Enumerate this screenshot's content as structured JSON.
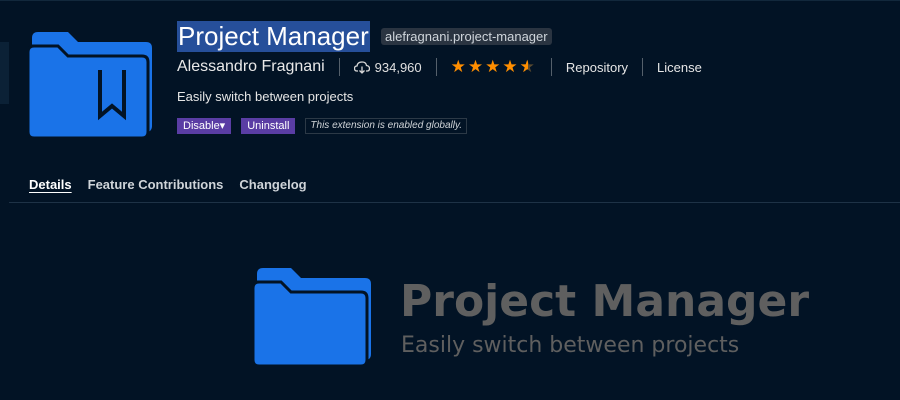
{
  "extension": {
    "name": "Project Manager",
    "identifier": "alefragnani.project-manager",
    "publisher": "Alessandro Fragnani",
    "install_count": "934,960",
    "rating_stars": 4.5,
    "rating_glyphs": "★★★★★",
    "description": "Easily switch between projects",
    "links": {
      "repository": "Repository",
      "license": "License"
    },
    "actions": {
      "disable_label": "Disable▾",
      "uninstall_label": "Uninstall",
      "status_message": "This extension is enabled globally."
    }
  },
  "tabs": [
    {
      "label": "Details",
      "active": true
    },
    {
      "label": "Feature Contributions",
      "active": false
    },
    {
      "label": "Changelog",
      "active": false
    }
  ],
  "readme_banner": {
    "title": "Project Manager",
    "subtitle": "Easily switch between projects"
  },
  "icons": {
    "extension_icon": "folder-bookmark-icon",
    "download_icon": "cloud-download-icon",
    "banner_icon": "folder-icon"
  },
  "colors": {
    "background": "#021325",
    "icon_blue": "#1a73e8",
    "star": "#ff8e00",
    "button": "#5a3da4",
    "title_highlight": "#264f9a",
    "banner_text": "#5f5f5f"
  }
}
